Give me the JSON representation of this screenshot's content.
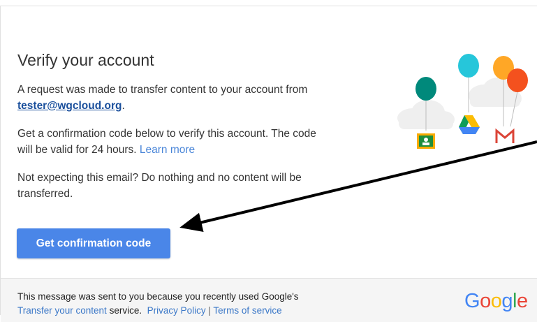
{
  "email": {
    "heading": "Verify your account",
    "para1_prefix": "A request was made to transfer content to your account from ",
    "sender": "tester@wgcloud.org",
    "para1_suffix": ".",
    "para2": "Get a confirmation code below to verify this account. The code will be valid for 24 hours. ",
    "learn_more": "Learn more",
    "para3": "Not expecting this email? Do nothing and no content will be transferred.",
    "cta_label": "Get confirmation code"
  },
  "footer": {
    "line1": "This message was sent to you because you recently used Google's",
    "transfer_link": "Transfer your content",
    "service_text": " service.",
    "privacy_link": "Privacy Policy",
    "separator": "|",
    "terms_link": "Terms of service"
  },
  "logo": {
    "letters": [
      "G",
      "o",
      "o",
      "g",
      "l",
      "e"
    ],
    "colors": [
      "#4285f4",
      "#ea4335",
      "#fbbc05",
      "#4285f4",
      "#34a853",
      "#ea4335"
    ]
  },
  "colors": {
    "button": "#4a86e8",
    "link": "#4a86d8",
    "footer_bg": "#f5f5f5"
  },
  "icons": [
    "classroom-icon",
    "drive-icon",
    "gmail-icon",
    "balloon-icon",
    "cloud-icon",
    "arrow-annotation"
  ]
}
